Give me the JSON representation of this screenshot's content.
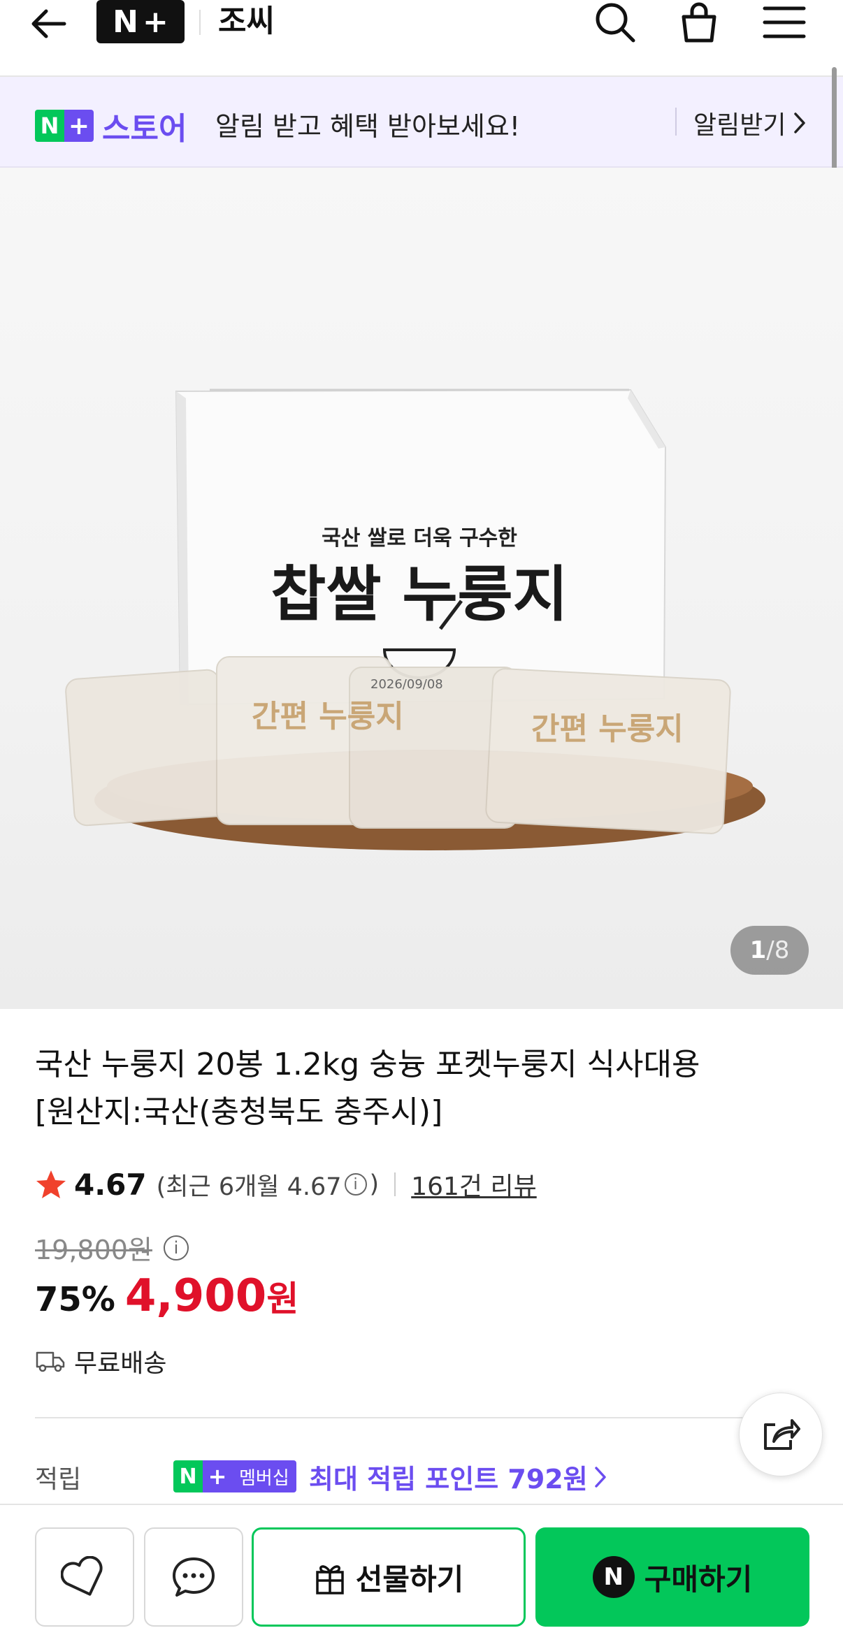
{
  "header": {
    "logo_n": "N",
    "logo_plus": "+",
    "store_name": "조씨"
  },
  "banner": {
    "logo_n": "N",
    "logo_plus": "+",
    "store_label": "스토어",
    "text": "알림 받고 혜택 받아보세요!",
    "action_label": "알림받기"
  },
  "product_image": {
    "box_subtitle": "국산 쌀로 더욱 구수한",
    "box_title": "찹쌀 누룽지",
    "packet_label": "간편 누룽지",
    "packet_date": "2026/09/08",
    "counter_current": "1",
    "counter_sep": "/",
    "counter_total": "8"
  },
  "product": {
    "title_line1": "국산 누룽지 20봉 1.2kg 숭늉 포켓누룽지 식사대용",
    "title_line2": "[원산지:국산(충청북도 충주시)]",
    "rating": "4.67",
    "recent_rating_prefix": "(최근 6개월 4.67",
    "recent_rating_suffix": ")",
    "review_count": "161건 리뷰",
    "original_price": "19,800원",
    "discount": "75%",
    "price": "4,900",
    "price_unit": "원",
    "shipping": "무료배송"
  },
  "points": {
    "label": "적립",
    "badge_n": "N",
    "badge_plus": "+",
    "badge_text": "멤버십",
    "text": "최대 적립 포인트 792원"
  },
  "bottom_bar": {
    "gift_label": "선물하기",
    "buy_n": "N",
    "buy_label": "구매하기"
  },
  "colors": {
    "naver_green": "#03c75a",
    "plus_purple": "#6b4df0",
    "price_red": "#e0112a"
  }
}
